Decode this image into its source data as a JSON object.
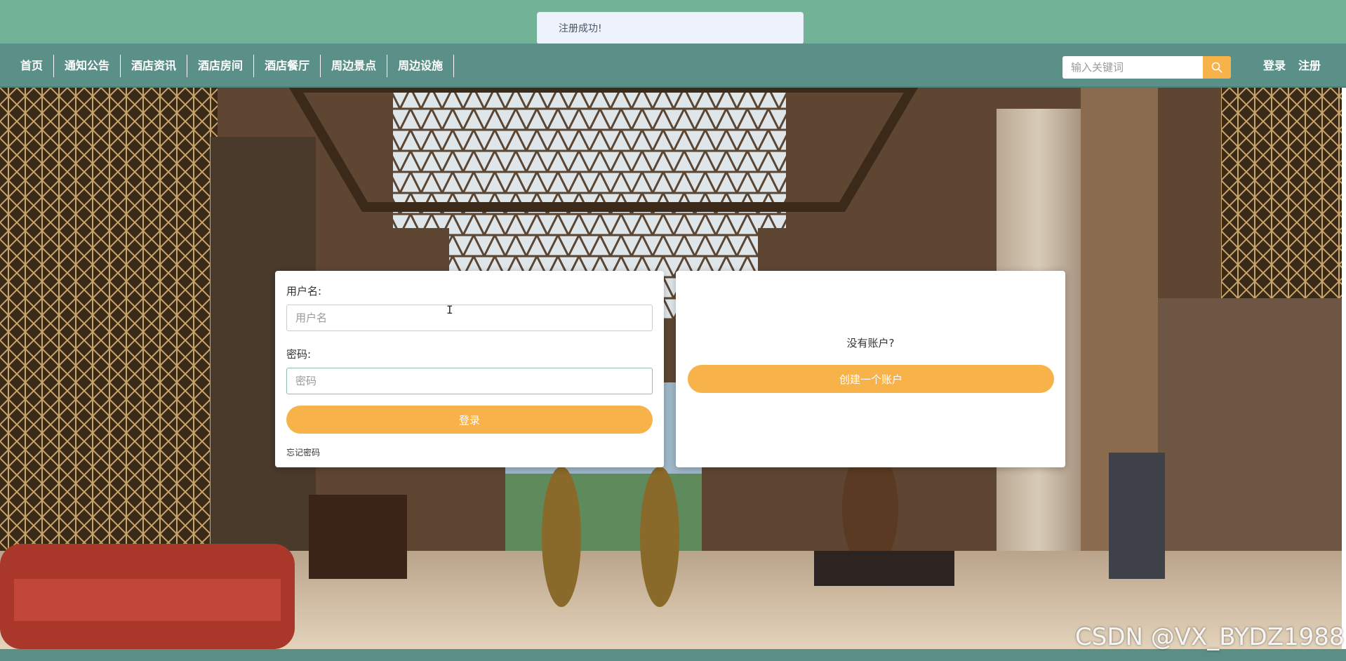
{
  "toast": {
    "message": "注册成功!"
  },
  "nav": {
    "items": [
      {
        "label": "首页"
      },
      {
        "label": "通知公告"
      },
      {
        "label": "酒店资讯"
      },
      {
        "label": "酒店房间"
      },
      {
        "label": "酒店餐厅"
      },
      {
        "label": "周边景点"
      },
      {
        "label": "周边设施"
      }
    ],
    "search_placeholder": "输入关键词",
    "search_icon": "search-icon",
    "login_label": "登录",
    "register_label": "注册"
  },
  "hero": {
    "background": "hotel-lobby-photo"
  },
  "login_form": {
    "username_label": "用户名:",
    "username_placeholder": "用户名",
    "password_label": "密码:",
    "password_placeholder": "密码",
    "submit_label": "登录",
    "forgot_label": "忘记密码"
  },
  "register_panel": {
    "prompt": "没有账户?",
    "create_label": "创建一个账户"
  },
  "watermark": {
    "text": "CSDN @VX_BYDZ1988"
  },
  "colors": {
    "topbar": "#72b397",
    "navbar": "#5b9089",
    "accent": "#f7b24a",
    "toast_bg": "#edf2fc"
  }
}
